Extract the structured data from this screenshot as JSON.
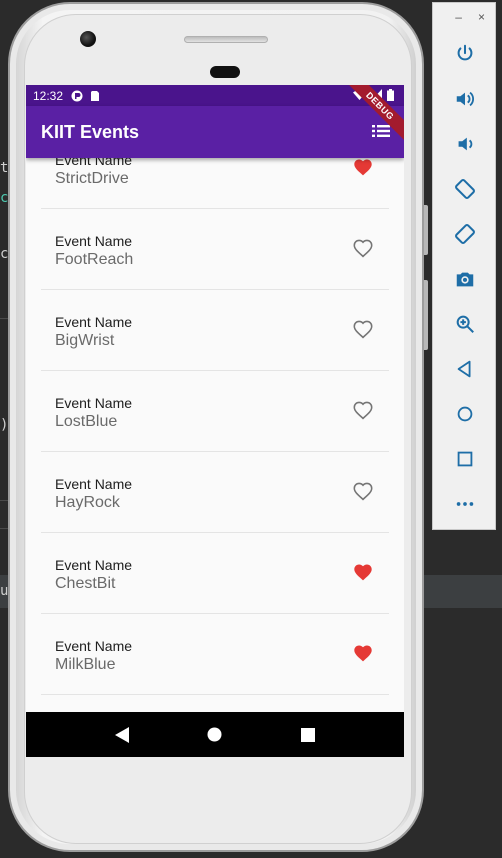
{
  "status_bar": {
    "time": "12:32"
  },
  "app_bar": {
    "title": "KIIT Events",
    "debug_banner": "DEBUG"
  },
  "events": [
    {
      "label": "Event Name",
      "name": "StrictDrive",
      "favorite": true
    },
    {
      "label": "Event Name",
      "name": "FootReach",
      "favorite": false
    },
    {
      "label": "Event Name",
      "name": "BigWrist",
      "favorite": false
    },
    {
      "label": "Event Name",
      "name": "LostBlue",
      "favorite": false
    },
    {
      "label": "Event Name",
      "name": "HayRock",
      "favorite": false
    },
    {
      "label": "Event Name",
      "name": "ChestBit",
      "favorite": true
    },
    {
      "label": "Event Name",
      "name": "MilkBlue",
      "favorite": true
    }
  ],
  "emulator": {
    "window_controls": [
      "–",
      "×"
    ],
    "buttons": [
      "power-icon",
      "volume-up-icon",
      "volume-down-icon",
      "rotate-left-icon",
      "rotate-right-icon",
      "camera-icon",
      "zoom-icon",
      "back-icon",
      "home-icon",
      "overview-icon",
      "more-icon"
    ]
  },
  "ide_glyphs": [
    "t",
    "c",
    "c",
    ")",
    "u"
  ],
  "colors": {
    "status_bar": "#4a148c",
    "app_bar": "#5a20a4",
    "favorite_heart": "#e53935",
    "empty_heart": "#757575"
  }
}
